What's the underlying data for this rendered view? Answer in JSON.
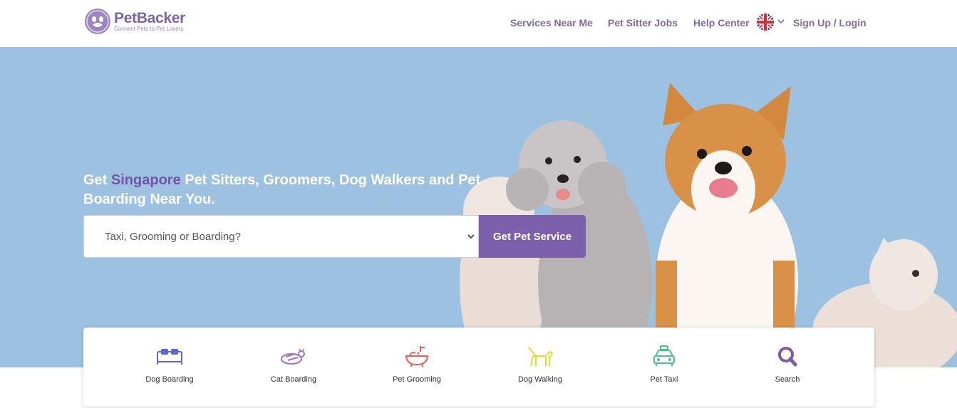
{
  "brand": {
    "name": "PetBacker",
    "tagline": "Connect Pets to Pet Lovers",
    "color": "#7b64a9"
  },
  "nav": {
    "services": "Services Near Me",
    "jobs": "Pet Sitter Jobs",
    "help": "Help Center",
    "language_icon": "uk-flag-icon",
    "login": "Sign Up / Login"
  },
  "hero": {
    "headline_prefix": "Get ",
    "city": "Singapore",
    "headline_rest": " Pet Sitters, Groomers, Dog Walkers and Pet Boarding Near You.",
    "search_placeholder": "Taxi, Grooming or Boarding?",
    "cta_label": "Get Pet Service",
    "background_color": "#9dc1e0",
    "accent_color": "#7d60ac"
  },
  "services": [
    {
      "label": "Dog Boarding",
      "icon": "dog-boarding-icon",
      "color": "#5b66d6"
    },
    {
      "label": "Cat Boarding",
      "icon": "cat-boarding-icon",
      "color": "#a56fc9"
    },
    {
      "label": "Pet Grooming",
      "icon": "pet-grooming-icon",
      "color": "#f05a5a"
    },
    {
      "label": "Dog Walking",
      "icon": "dog-walking-icon",
      "color": "#e6d92a"
    },
    {
      "label": "Pet Taxi",
      "icon": "pet-taxi-icon",
      "color": "#4bc48a"
    },
    {
      "label": "Search",
      "icon": "search-icon",
      "color": "#7b5aa6"
    }
  ]
}
